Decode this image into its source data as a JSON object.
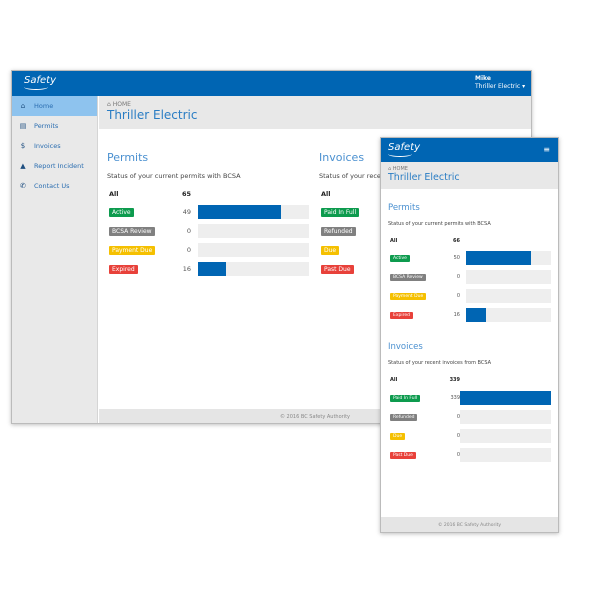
{
  "brand": {
    "logo": "Safety",
    "colors": {
      "primary": "#0065b3",
      "active": "#0d9b4e",
      "review": "#808080",
      "due": "#f5c000",
      "expired": "#e8413a"
    }
  },
  "user": {
    "name": "Mike",
    "company": "Thriller Electric"
  },
  "sidebar": {
    "items": [
      {
        "label": "Home",
        "icon": "home-icon"
      },
      {
        "label": "Permits",
        "icon": "file-icon"
      },
      {
        "label": "Invoices",
        "icon": "dollar-icon"
      },
      {
        "label": "Report Incident",
        "icon": "warning-icon"
      },
      {
        "label": "Contact Us",
        "icon": "phone-icon"
      }
    ]
  },
  "breadcrumb": "HOME",
  "page_title": "Thriller Electric",
  "footer": "© 2016 BC Safety Authority",
  "desktop": {
    "permits": {
      "title": "Permits",
      "desc": "Status of your current permits with BCSA",
      "all_label": "All",
      "all_count": "65",
      "rows": [
        {
          "label": "Active",
          "count": "49",
          "pct": 75,
          "color": "#0d9b4e"
        },
        {
          "label": "BCSA Review",
          "count": "0",
          "pct": 0,
          "color": "#808080"
        },
        {
          "label": "Payment Due",
          "count": "0",
          "pct": 0,
          "color": "#f5c000"
        },
        {
          "label": "Expired",
          "count": "16",
          "pct": 25,
          "color": "#e8413a"
        }
      ]
    },
    "invoices": {
      "title": "Invoices",
      "desc": "Status of your recent invoices from BCSA",
      "all_label": "All",
      "rows": [
        {
          "label": "Paid In Full",
          "color": "#0d9b4e"
        },
        {
          "label": "Refunded",
          "color": "#808080"
        },
        {
          "label": "Due",
          "color": "#f5c000"
        },
        {
          "label": "Past Due",
          "color": "#e8413a"
        }
      ]
    }
  },
  "mobile": {
    "permits": {
      "title": "Permits",
      "desc": "Status of your current permits with BCSA",
      "all_label": "All",
      "all_count": "66",
      "rows": [
        {
          "label": "Active",
          "count": "50",
          "pct": 76,
          "color": "#0d9b4e"
        },
        {
          "label": "BCSA Review",
          "count": "0",
          "pct": 0,
          "color": "#808080"
        },
        {
          "label": "Payment Due",
          "count": "0",
          "pct": 0,
          "color": "#f5c000"
        },
        {
          "label": "Expired",
          "count": "16",
          "pct": 24,
          "color": "#e8413a"
        }
      ]
    },
    "invoices": {
      "title": "Invoices",
      "desc": "Status of your recent invoices from BCSA",
      "all_label": "All",
      "all_count": "339",
      "rows": [
        {
          "label": "Paid In Full",
          "count": "339",
          "pct": 100,
          "color": "#0d9b4e"
        },
        {
          "label": "Refunded",
          "count": "0",
          "pct": 0,
          "color": "#808080"
        },
        {
          "label": "Due",
          "count": "0",
          "pct": 0,
          "color": "#f5c000"
        },
        {
          "label": "Past Due",
          "count": "0",
          "pct": 0,
          "color": "#e8413a"
        }
      ]
    }
  }
}
